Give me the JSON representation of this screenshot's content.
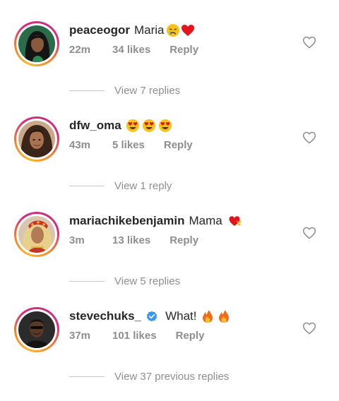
{
  "comments": [
    {
      "username": "peaceogor",
      "text": "Maria",
      "emojis": [
        "sad-face-emoji",
        "red-heart-emoji"
      ],
      "time": "22m",
      "likes": "34 likes",
      "reply": "Reply",
      "view_replies": "View 7 replies",
      "verified": false
    },
    {
      "username": "dfw_oma",
      "text": "",
      "emojis": [
        "heart-eyes-emoji",
        "heart-eyes-emoji",
        "heart-eyes-emoji"
      ],
      "time": "43m",
      "likes": "5 likes",
      "reply": "Reply",
      "view_replies": "View 1 reply",
      "verified": false
    },
    {
      "username": "mariachikebenjamin",
      "text": "Mama",
      "emojis": [
        "heart-with-ribbon-emoji"
      ],
      "time": "3m",
      "likes": "13 likes",
      "reply": "Reply",
      "view_replies": "View 5 replies",
      "verified": false
    },
    {
      "username": "stevechuks_",
      "text": "What!",
      "emojis": [
        "fire-emoji",
        "fire-emoji"
      ],
      "time": "37m",
      "likes": "101 likes",
      "reply": "Reply",
      "view_replies": "View 37 previous replies",
      "verified": true
    }
  ],
  "colors": {
    "text": "#262626",
    "secondary": "#8e8e8e",
    "divider": "#c7c7c7",
    "verified": "#3897f0"
  },
  "icons": {
    "like": "heart-outline-icon",
    "verified": "verified-badge-icon"
  }
}
